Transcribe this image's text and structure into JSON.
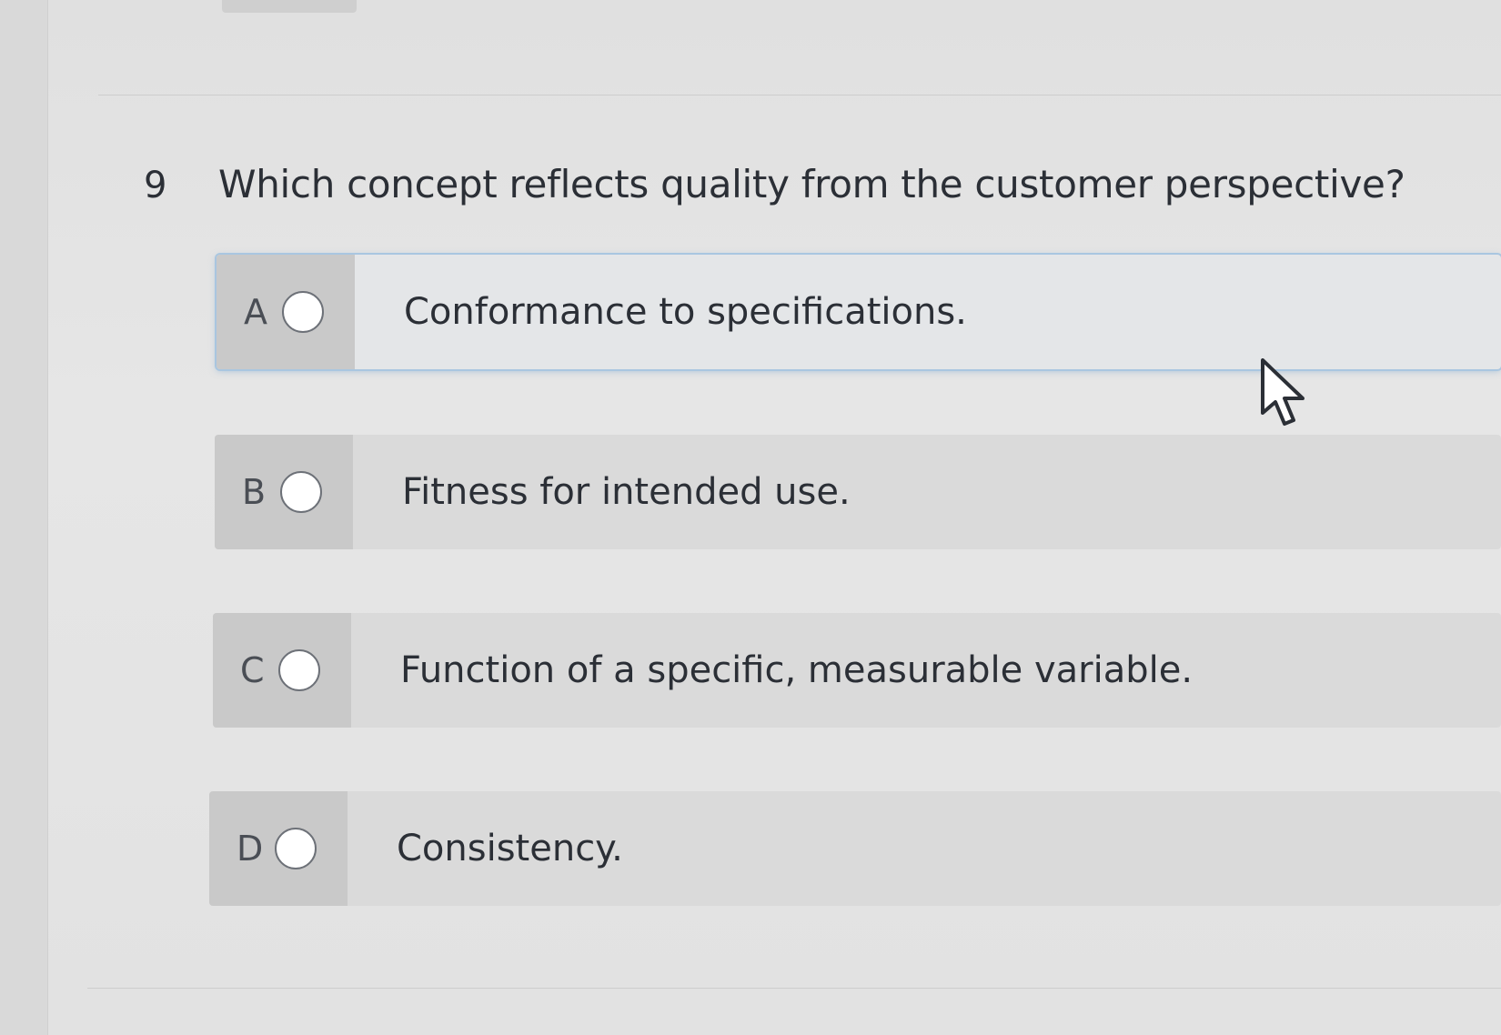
{
  "question": {
    "number": "9",
    "text": "Which concept reflects quality from the customer perspective?"
  },
  "options": [
    {
      "letter": "A",
      "text": "Conformance to specifications.",
      "selected": false,
      "highlighted": true
    },
    {
      "letter": "B",
      "text": "Fitness for intended use.",
      "selected": false,
      "highlighted": false
    },
    {
      "letter": "C",
      "text": "Function of a specific, measurable variable.",
      "selected": false,
      "highlighted": false
    },
    {
      "letter": "D",
      "text": "Consistency.",
      "selected": false,
      "highlighted": false
    }
  ],
  "colors": {
    "background": "#e3e3e3",
    "option_body": "#dadada",
    "option_head": "#c9c9c9",
    "highlight_glow": "#a9c6e0",
    "text": "#2b2f36"
  },
  "icons": {
    "radio": "radio-button-unselected-icon",
    "cursor": "mouse-pointer-icon"
  }
}
